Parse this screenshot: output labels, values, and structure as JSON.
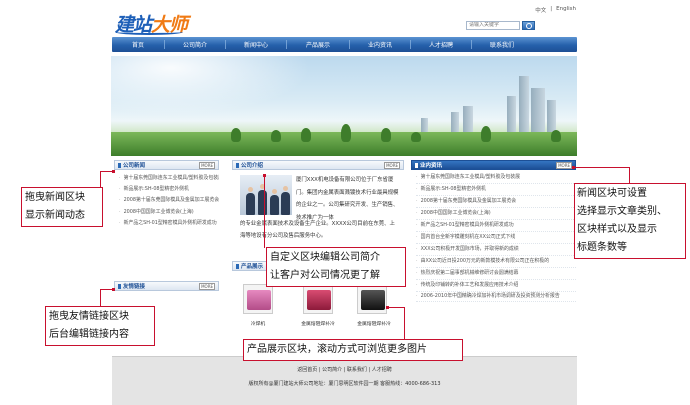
{
  "brand": {
    "logo_part1": "建站",
    "logo_part2": "大师"
  },
  "lang": {
    "zh": "中文",
    "sep": "|",
    "en": "English"
  },
  "search": {
    "placeholder": "请输入关键字"
  },
  "nav": [
    "首页",
    "公司简介",
    "新闻中心",
    "产品展示",
    "业内资讯",
    "人才招聘",
    "联系我们"
  ],
  "news": {
    "title": "公司新闻",
    "more": "MORE",
    "items": [
      "第十届东莞国际连东工业模具/塑料胶及包装展",
      "新品展示:SH-08型精密外侧机",
      "2008第十届东莞国际模具及金属加工展览会",
      "2008中国国际工业博览会(上海)",
      "新产品之SH-01型精密模具外侧机研发成功"
    ]
  },
  "friend": {
    "title": "友情链接",
    "more": "MORE"
  },
  "intro": {
    "title": "公司介绍",
    "more": "MORE",
    "text_side": "厦门XXX机电设备有限公司位于厂东省厦门。集团内金属表面溅镀技术行业最具规模的企业之一。公司集研究开发、生产销售、技术推广为一体",
    "text_bottom": "的专业金属表面技术及设备生产企业。XXXX公司目前在东莞、上海等地设有分公司及售后服务中心。"
  },
  "products": {
    "title": "产品展示",
    "more": "MORE",
    "items": [
      "冷焊机",
      "金属熔阻焊补冷",
      "金属熔阻焊补冷"
    ]
  },
  "industry": {
    "title": "业内资讯",
    "more": "MORE",
    "items": [
      "第十届东莞国际连东工业模具/塑料胶及包装展",
      "新品展示:SH-08型精密外侧机",
      "2008第十届东莞国际模具及金属加工展览会",
      "2008中国国际工业博览会(上海)",
      "新产品之SH-01型精密模具外侧机研发成功",
      "国内首台全新字模雕刻机在XX公司正式下线",
      "XXX公司积极开发国际市场，并取得新的成绩",
      "由XX公司近日投200万元的新款模技术有限公司正在积极的",
      "热烈庆祝第二届事部机械维修研讨会圆满结幕",
      "传统及印铺转的补体工艺和发展应用技术介绍",
      "2006-2010年中国精确冷焊加补机市场调研及投资预测分析报告"
    ]
  },
  "footer": {
    "links": "返回首页  |  公司简介  |  联系我们  |  人才招聘",
    "copy": "版权所有@厦门建站大师公司地址：厦门思明区软件园一期  客服热线：4000-686-313"
  },
  "callouts": {
    "news": "拖曳新闻区块\n显示新闻动态",
    "friend": "拖曳友情链接区块\n后台编辑链接内容",
    "intro": "自定义区块编辑公司简介\n让客户对公司情况更了解",
    "products": "产品展示区块，滚动方式可浏览更多图片",
    "industry": "新闻区块可设置\n选择显示文章类别、\n区块样式以及显示\n标题条数等"
  }
}
